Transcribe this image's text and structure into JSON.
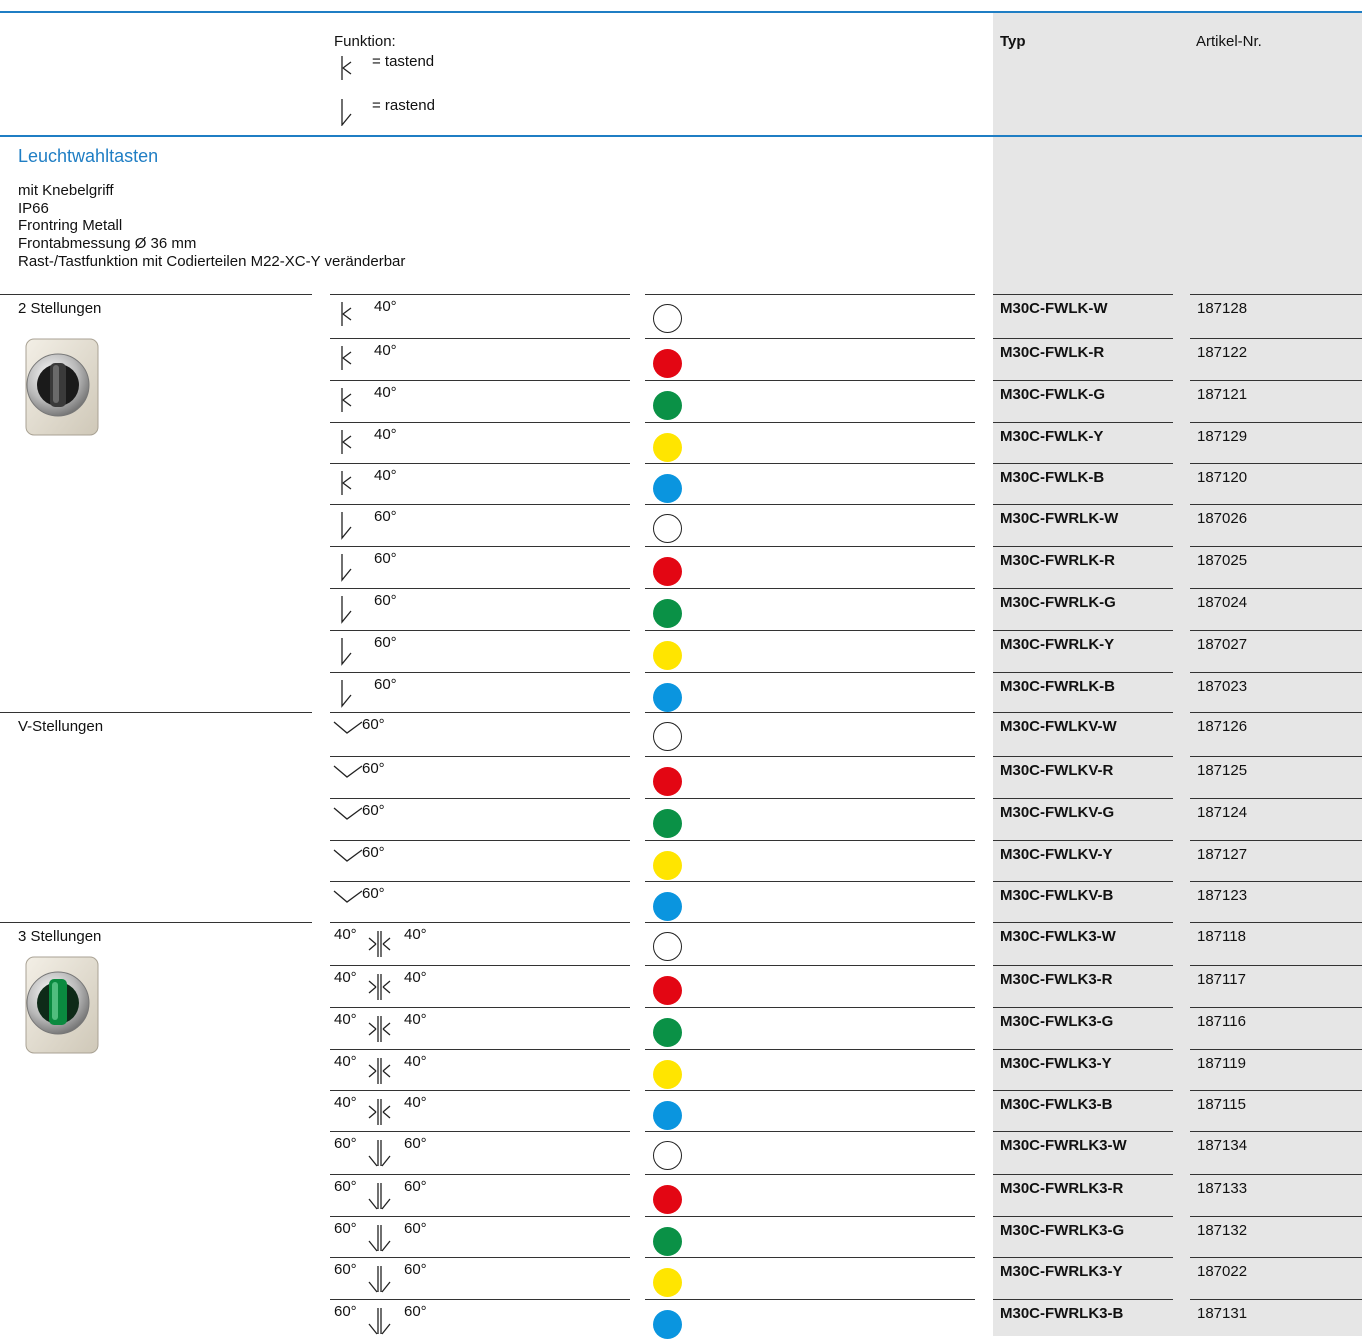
{
  "header": {
    "funktion_label": "Funktion:",
    "tastend_label": "= tastend",
    "rastend_label": "= rastend",
    "typ_header": "Typ",
    "artikel_header": "Artikel-Nr."
  },
  "section": {
    "title": "Leuchtwahltasten",
    "details": [
      "mit Knebelgriff",
      "IP66",
      "Frontring Metall",
      "Frontabmessung Ø 36 mm",
      "Rast-/Tastfunktion mit Codierteilen M22-XC-Y veränderbar"
    ]
  },
  "colors": {
    "accent_blue": "#1f7ec4",
    "white": "#ffffff",
    "red": "#e30613",
    "green": "#0a9146",
    "yellow": "#ffe500",
    "blue": "#0a95df"
  },
  "groups": [
    {
      "label": "2 Stellungen",
      "rows": [
        {
          "symbol": "tastend",
          "angle": "40°",
          "color": "white",
          "typ": "M30C-FWLK-W",
          "artikel": "187128"
        },
        {
          "symbol": "tastend",
          "angle": "40°",
          "color": "red",
          "typ": "M30C-FWLK-R",
          "artikel": "187122"
        },
        {
          "symbol": "tastend",
          "angle": "40°",
          "color": "green",
          "typ": "M30C-FWLK-G",
          "artikel": "187121"
        },
        {
          "symbol": "tastend",
          "angle": "40°",
          "color": "yellow",
          "typ": "M30C-FWLK-Y",
          "artikel": "187129"
        },
        {
          "symbol": "tastend",
          "angle": "40°",
          "color": "blue",
          "typ": "M30C-FWLK-B",
          "artikel": "187120"
        },
        {
          "symbol": "rastend",
          "angle": "60°",
          "color": "white",
          "typ": "M30C-FWRLK-W",
          "artikel": "187026"
        },
        {
          "symbol": "rastend",
          "angle": "60°",
          "color": "red",
          "typ": "M30C-FWRLK-R",
          "artikel": "187025"
        },
        {
          "symbol": "rastend",
          "angle": "60°",
          "color": "green",
          "typ": "M30C-FWRLK-G",
          "artikel": "187024"
        },
        {
          "symbol": "rastend",
          "angle": "60°",
          "color": "yellow",
          "typ": "M30C-FWRLK-Y",
          "artikel": "187027"
        },
        {
          "symbol": "rastend",
          "angle": "60°",
          "color": "blue",
          "typ": "M30C-FWRLK-B",
          "artikel": "187023"
        }
      ]
    },
    {
      "label": "V-Stellungen",
      "rows": [
        {
          "symbol": "v",
          "angle": "60°",
          "color": "white",
          "typ": "M30C-FWLKV-W",
          "artikel": "187126"
        },
        {
          "symbol": "v",
          "angle": "60°",
          "color": "red",
          "typ": "M30C-FWLKV-R",
          "artikel": "187125"
        },
        {
          "symbol": "v",
          "angle": "60°",
          "color": "green",
          "typ": "M30C-FWLKV-G",
          "artikel": "187124"
        },
        {
          "symbol": "v",
          "angle": "60°",
          "color": "yellow",
          "typ": "M30C-FWLKV-Y",
          "artikel": "187127"
        },
        {
          "symbol": "v",
          "angle": "60°",
          "color": "blue",
          "typ": "M30C-FWLKV-B",
          "artikel": "187123"
        }
      ]
    },
    {
      "label": "3 Stellungen",
      "rows": [
        {
          "symbol": "tast3",
          "left": "40°",
          "angle": "40°",
          "color": "white",
          "typ": "M30C-FWLK3-W",
          "artikel": "187118"
        },
        {
          "symbol": "tast3",
          "left": "40°",
          "angle": "40°",
          "color": "red",
          "typ": "M30C-FWLK3-R",
          "artikel": "187117"
        },
        {
          "symbol": "tast3",
          "left": "40°",
          "angle": "40°",
          "color": "green",
          "typ": "M30C-FWLK3-G",
          "artikel": "187116"
        },
        {
          "symbol": "tast3",
          "left": "40°",
          "angle": "40°",
          "color": "yellow",
          "typ": "M30C-FWLK3-Y",
          "artikel": "187119"
        },
        {
          "symbol": "tast3",
          "left": "40°",
          "angle": "40°",
          "color": "blue",
          "typ": "M30C-FWLK3-B",
          "artikel": "187115"
        },
        {
          "symbol": "rast3",
          "left": "60°",
          "angle": "60°",
          "color": "white",
          "typ": "M30C-FWRLK3-W",
          "artikel": "187134"
        },
        {
          "symbol": "rast3",
          "left": "60°",
          "angle": "60°",
          "color": "red",
          "typ": "M30C-FWRLK3-R",
          "artikel": "187133"
        },
        {
          "symbol": "rast3",
          "left": "60°",
          "angle": "60°",
          "color": "green",
          "typ": "M30C-FWRLK3-G",
          "artikel": "187132"
        },
        {
          "symbol": "rast3",
          "left": "60°",
          "angle": "60°",
          "color": "yellow",
          "typ": "M30C-FWRLK3-Y",
          "artikel": "187022"
        },
        {
          "symbol": "rast3",
          "left": "60°",
          "angle": "60°",
          "color": "blue",
          "typ": "M30C-FWRLK3-B",
          "artikel": "187131"
        }
      ]
    }
  ]
}
